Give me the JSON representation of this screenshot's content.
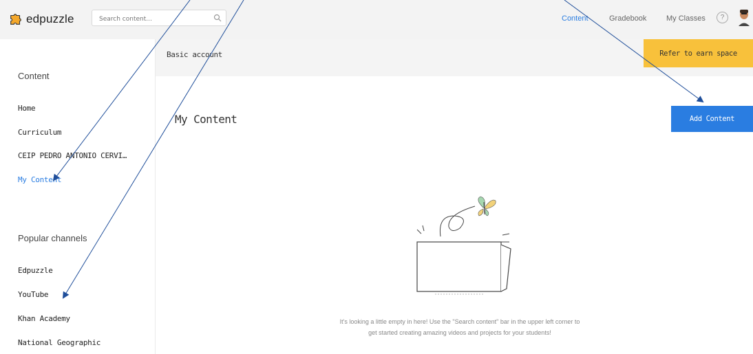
{
  "app": {
    "name": "edpuzzle",
    "brand_color": "#f4a82b",
    "accent_color": "#2a7de1"
  },
  "header": {
    "search": {
      "placeholder": "Search content..."
    },
    "nav": {
      "content": "Content",
      "gradebook": "Gradebook",
      "my_classes": "My Classes"
    },
    "help_symbol": "?"
  },
  "sidebar": {
    "content_heading": "Content",
    "content_items": [
      "Home",
      "Curriculum",
      "CEIP PEDRO ANTONIO CERVI…",
      "My Content"
    ],
    "active_item": "My Content",
    "channels_heading": "Popular channels",
    "channel_items": [
      "Edpuzzle",
      "YouTube",
      "Khan Academy",
      "National Geographic"
    ]
  },
  "banner": {
    "text": "Basic account",
    "refer_button": "Refer to earn space",
    "refer_color": "#f8c13b"
  },
  "main": {
    "title": "My Content",
    "add_button": "Add Content",
    "empty_message": "It's looking a little empty in here! Use the \"Search content\" bar in the upper left corner to get started creating amazing videos and projects for your students!"
  },
  "annotations": {
    "arrow_color": "#1f4e9a"
  }
}
